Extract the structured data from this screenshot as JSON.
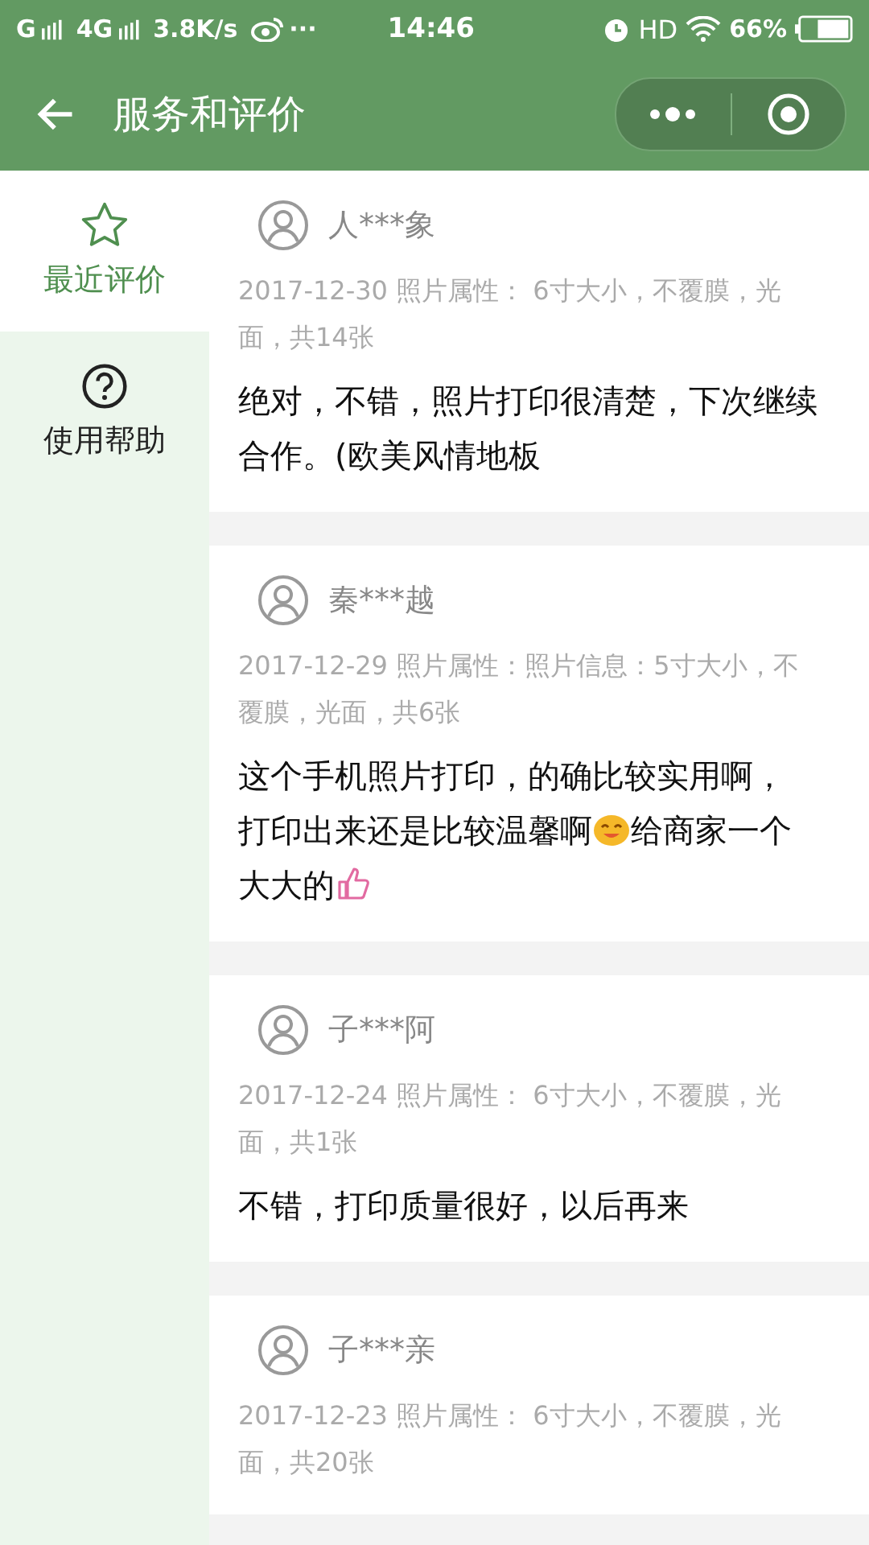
{
  "status_bar": {
    "sim1": "G",
    "sim2": "4G",
    "speed": "3.8K/s",
    "more": "···",
    "time": "14:46",
    "hd": "HD",
    "battery": "66%"
  },
  "header": {
    "title": "服务和评价"
  },
  "sidebar": {
    "items": [
      {
        "label": "最近评价",
        "kind": "star",
        "selected": true
      },
      {
        "label": "使用帮助",
        "kind": "help",
        "selected": false
      }
    ]
  },
  "reviews": [
    {
      "user": "人***象",
      "meta": "2017-12-30 照片属性：  6寸大小，不覆膜，光面，共14张",
      "parts": [
        {
          "kind": "text",
          "text": "绝对，不错，照片打印很清楚，下次继续合作。(欧美风情地板"
        }
      ]
    },
    {
      "user": "秦***越",
      "meta": "2017-12-29 照片属性：照片信息：5寸大小，不覆膜，光面，共6张",
      "parts": [
        {
          "kind": "text",
          "text": "这个手机照片打印，的确比较实用啊，"
        },
        {
          "kind": "text",
          "text": "打印出来还是比较温馨啊"
        },
        {
          "kind": "smiley"
        },
        {
          "kind": "text",
          "text": "给商家一个"
        },
        {
          "kind": "text",
          "text": "大大的"
        },
        {
          "kind": "thumbs-up"
        }
      ]
    },
    {
      "user": "子***阿",
      "meta": "2017-12-24 照片属性：  6寸大小，不覆膜，光面，共1张",
      "parts": [
        {
          "kind": "text",
          "text": "不错，打印质量很好，以后再来"
        }
      ]
    },
    {
      "user": "子***亲",
      "meta": "2017-12-23 照片属性：  6寸大小，不覆膜，光面，共20张"
    }
  ]
}
